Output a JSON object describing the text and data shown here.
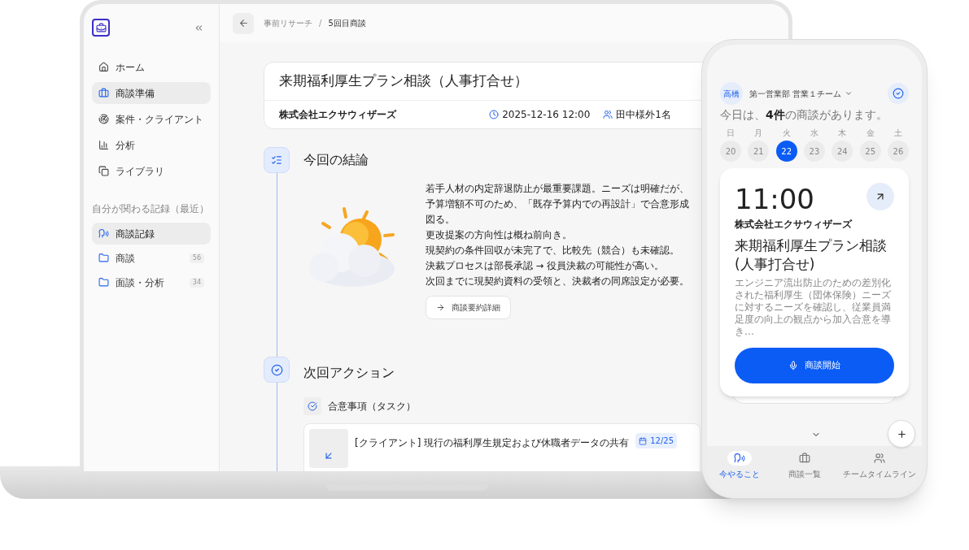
{
  "laptop": {
    "sidebar": {
      "nav": [
        {
          "label": "ホーム",
          "selected": false
        },
        {
          "label": "商談準備",
          "selected": true
        },
        {
          "label": "案件・クライアント",
          "selected": false
        },
        {
          "label": "分析",
          "selected": false
        },
        {
          "label": "ライブラリ",
          "selected": false
        }
      ],
      "section_title": "自分が関わる記録（最近）",
      "records": [
        {
          "label": "商談記録",
          "selected": true
        },
        {
          "label": "商談",
          "count": "56",
          "selected": false
        },
        {
          "label": "面談・分析",
          "count": "34",
          "selected": false
        }
      ]
    },
    "breadcrumb": {
      "items": [
        "事前リサーチ",
        "5回目商談"
      ],
      "separator": "/"
    },
    "meeting": {
      "title": "来期福利厚生プラン相談（人事打合せ）",
      "company": "株式会社エクサウィザーズ",
      "datetime": "2025-12-16 12:00",
      "attendees": "田中様外1名"
    },
    "conclusion": {
      "heading": "今回の結論",
      "lines": [
        "若手人材の内定辞退防止が最重要課題。ニーズは明確だが、",
        "予算増額不可のため、「既存予算内での再設計」で合意形成",
        "図る。",
        "更改提案の方向性は概ね前向き。",
        "現契約の条件回収が未完了で、比較先（競合）も未確認。",
        "決裁プロセスは部長承認 → 役員決裁の可能性が高い。",
        "次回までに現契約資料の受領と、決裁者の同席設定が必要。"
      ],
      "button": "商談要約詳細"
    },
    "next_action": {
      "heading": "次回アクション",
      "subheading": "合意事項（タスク）",
      "tasks": [
        {
          "text": "[クライアント] 現行の福利厚生規定および休職者データの共有",
          "due": "12/25"
        }
      ]
    }
  },
  "phone": {
    "user": "高橋",
    "team": "第一営業部 営業１チーム",
    "greeting": "今日は、**4件**の商談があります。",
    "days": [
      {
        "weekday": "日",
        "date": "20",
        "selected": false
      },
      {
        "weekday": "月",
        "date": "21",
        "selected": false
      },
      {
        "weekday": "火",
        "date": "22",
        "selected": true
      },
      {
        "weekday": "水",
        "date": "23",
        "selected": false
      },
      {
        "weekday": "木",
        "date": "24",
        "selected": false
      },
      {
        "weekday": "金",
        "date": "25",
        "selected": false
      },
      {
        "weekday": "土",
        "date": "26",
        "selected": false
      }
    ],
    "meeting": {
      "time": "11:00",
      "company": "株式会社エクサウィザーズ",
      "title": "来期福利厚生プラン相談(人事打合せ)",
      "description": "エンジニア流出防止のための差別化された福利厚生（団体保険）ニーズに対するニーズを確認し、従業員満足度の向上の観点から加入合意を導き…",
      "button": "商談開始"
    },
    "nav": [
      {
        "label": "今やること",
        "selected": true
      },
      {
        "label": "商談一覧",
        "selected": false
      },
      {
        "label": "チームタイムライン",
        "selected": false
      }
    ]
  }
}
